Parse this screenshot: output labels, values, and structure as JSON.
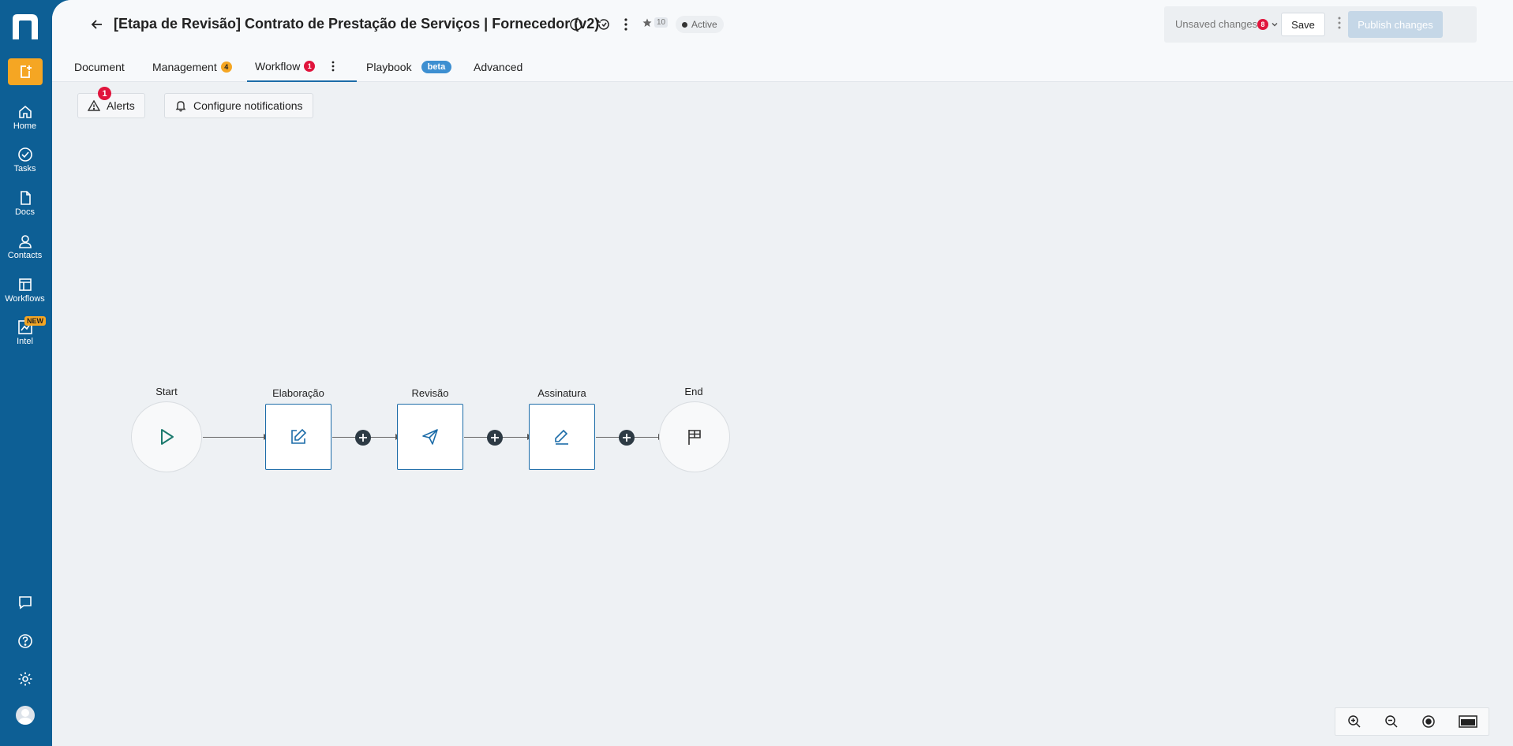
{
  "sidebar": {
    "items": [
      {
        "label": "Home"
      },
      {
        "label": "Tasks"
      },
      {
        "label": "Docs"
      },
      {
        "label": "Contacts"
      },
      {
        "label": "Workflows"
      },
      {
        "label": "Intel",
        "badge": "NEW"
      }
    ]
  },
  "header": {
    "title": "[Etapa de Revisão] Contrato de Prestação de Serviços | Fornecedor (v2)",
    "star_count": "10",
    "status": "Active",
    "unsaved_label": "Unsaved changes",
    "unsaved_count": "8",
    "save_label": "Save",
    "publish_label": "Publish changes"
  },
  "tabs": [
    {
      "label": "Document"
    },
    {
      "label": "Management",
      "badge": "4"
    },
    {
      "label": "Workflow",
      "badge": "1",
      "active": true
    },
    {
      "label": "Playbook",
      "tag": "beta"
    },
    {
      "label": "Advanced"
    }
  ],
  "toolbar": {
    "alerts_label": "Alerts",
    "alerts_count": "1",
    "notifications_label": "Configure notifications"
  },
  "workflow": {
    "nodes": [
      {
        "label": "Start",
        "type": "start",
        "icon": "play-icon"
      },
      {
        "label": "Elaboração",
        "type": "step",
        "icon": "edit-icon"
      },
      {
        "label": "Revisão",
        "type": "step",
        "icon": "send-icon"
      },
      {
        "label": "Assinatura",
        "type": "step",
        "icon": "sign-icon"
      },
      {
        "label": "End",
        "type": "end",
        "icon": "flag-icon"
      }
    ]
  },
  "colors": {
    "sidebar": "#0d5f95",
    "accent": "#1c6ca8",
    "create": "#f5a623",
    "alert": "#e0143c"
  }
}
